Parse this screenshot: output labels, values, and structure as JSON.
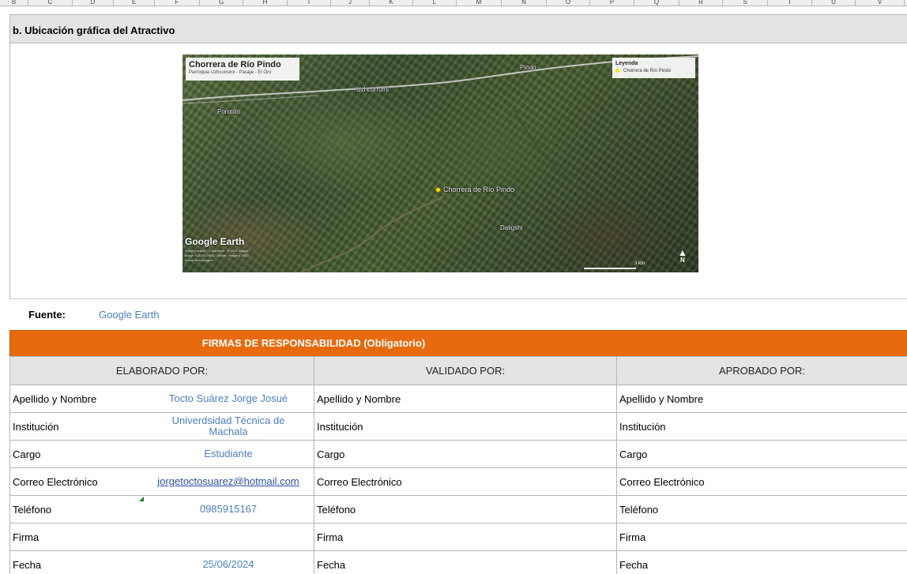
{
  "columns": [
    "B",
    "C",
    "D",
    "E",
    "F",
    "G",
    "H",
    "I",
    "J",
    "K",
    "L",
    "M",
    "N",
    "O",
    "P",
    "Q",
    "R",
    "S",
    "T",
    "U",
    "V"
  ],
  "section": {
    "title": "b. Ubicación gráfica del Atractivo"
  },
  "map": {
    "title": "Chorrera de Río Pindo",
    "subtitle": "Parroquia Uzhcurrumi - Pasaje - El Oro",
    "legend_title": "Leyenda",
    "legend_item": "Chorrera de Río Pindo",
    "places": {
      "pindo": "Pindo",
      "uzhcurrumi": "Uzhcurrumi",
      "porotillo": "Porotillo",
      "chorrera": "Chorrera de Río Pindo",
      "daligshi": "Daligshi"
    },
    "logo": "Google Earth",
    "credits": "Image Landsat / Copernicus · © 2021 Google · Image © 2020 CNES / Airbus · Image © 2020 Maxar Technologies",
    "scale_label": "3 km",
    "north_label": "N",
    "colors": {
      "marker": "#f6e000",
      "road": "#d9d9d9"
    }
  },
  "fuente": {
    "label": "Fuente:",
    "value": "Google Earth"
  },
  "firmas": {
    "title": "FIRMAS DE RESPONSABILIDAD (Obligatorio)",
    "color": "#e86a0f"
  },
  "table": {
    "headers": [
      "ELABORADO POR:",
      "VALIDADO  POR:",
      "APROBADO POR:"
    ],
    "rows": [
      {
        "label": "Apellido y Nombre",
        "value": "Tocto Suárez Jorge Josué"
      },
      {
        "label": "Institución",
        "value": "Univerdsidad Técnica de Machala"
      },
      {
        "label": "Cargo",
        "value": "Estudiante"
      },
      {
        "label": "Correo Electrónico",
        "value": "jorgetoctosuarez@hotmail.com"
      },
      {
        "label": "Teléfono",
        "value": "0985915167"
      },
      {
        "label": "Firma",
        "value": ""
      },
      {
        "label": "Fecha",
        "value": "25/06/2024"
      }
    ]
  }
}
